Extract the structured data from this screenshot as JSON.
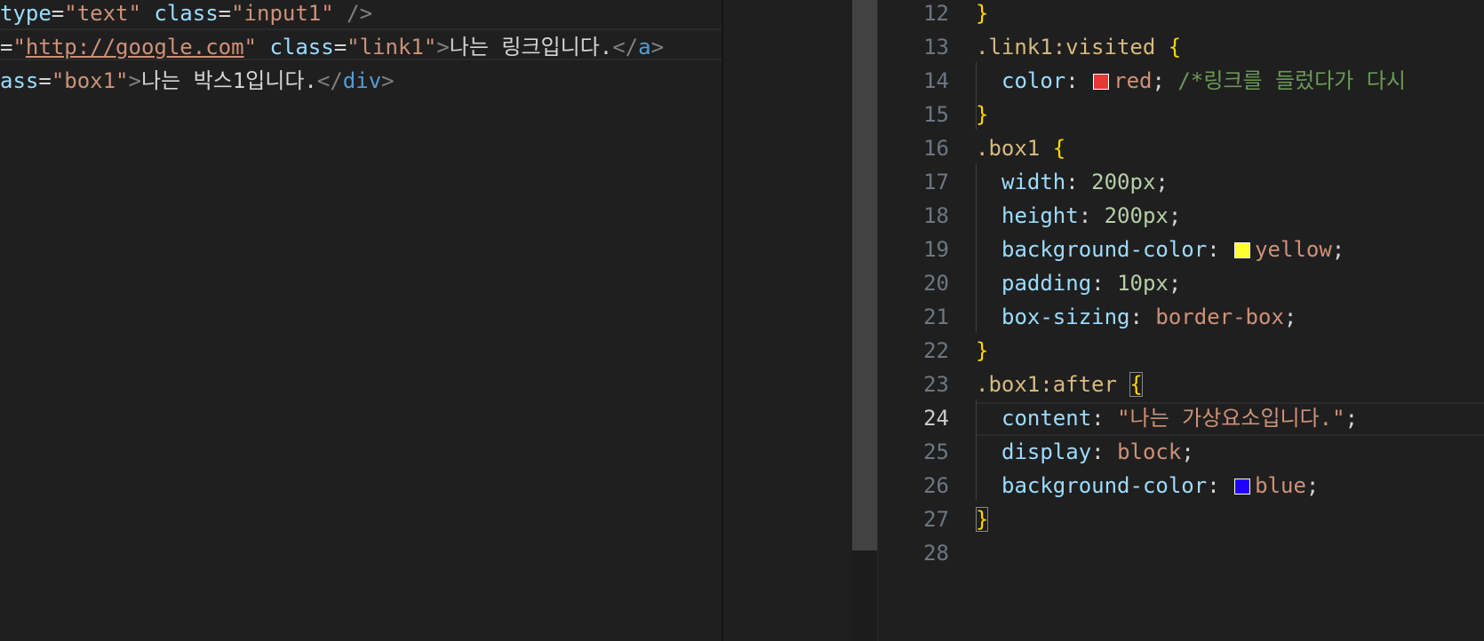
{
  "colors": {
    "background": "#1f1f1f",
    "swatch_red": "#e53935",
    "swatch_yellow": "#ffff33",
    "swatch_blue": "#2200ff"
  },
  "left_editor": {
    "lines": [
      {
        "tokens": [
          {
            "text": "type",
            "cls": "t-attr"
          },
          {
            "text": "=",
            "cls": "t-punct"
          },
          {
            "text": "\"text\"",
            "cls": "t-str"
          },
          {
            "text": " ",
            "cls": "t-punct"
          },
          {
            "text": "class",
            "cls": "t-attr"
          },
          {
            "text": "=",
            "cls": "t-punct"
          },
          {
            "text": "\"input1\"",
            "cls": "t-str"
          },
          {
            "text": " />",
            "cls": "t-tag"
          }
        ]
      },
      {
        "tokens": [
          {
            "text": "=",
            "cls": "t-punct"
          },
          {
            "text": "\"",
            "cls": "t-str"
          },
          {
            "text": "http://google.com",
            "cls": "t-link"
          },
          {
            "text": "\"",
            "cls": "t-str"
          },
          {
            "text": " ",
            "cls": "t-punct"
          },
          {
            "text": "class",
            "cls": "t-attr"
          },
          {
            "text": "=",
            "cls": "t-punct"
          },
          {
            "text": "\"link1\"",
            "cls": "t-str"
          },
          {
            "text": ">",
            "cls": "t-tag"
          },
          {
            "text": "나는 링크입니다.",
            "cls": "t-text"
          },
          {
            "text": "</",
            "cls": "t-tag"
          },
          {
            "text": "a",
            "cls": "t-tagname"
          },
          {
            "text": ">",
            "cls": "t-tag"
          }
        ]
      },
      {
        "tokens": [
          {
            "text": "ass",
            "cls": "t-attr"
          },
          {
            "text": "=",
            "cls": "t-punct"
          },
          {
            "text": "\"box1\"",
            "cls": "t-str"
          },
          {
            "text": ">",
            "cls": "t-tag"
          },
          {
            "text": "나는 박스1입니다.",
            "cls": "t-text"
          },
          {
            "text": "</",
            "cls": "t-tag"
          },
          {
            "text": "div",
            "cls": "t-tagname"
          },
          {
            "text": ">",
            "cls": "t-tag"
          }
        ]
      }
    ]
  },
  "right_editor": {
    "active_line": "24",
    "lines": [
      {
        "num": "12",
        "indent": 0,
        "tokens": [
          {
            "text": "}",
            "cls": "t-brace"
          }
        ]
      },
      {
        "num": "13",
        "indent": 0,
        "tokens": [
          {
            "text": ".link1:visited",
            "cls": "t-sel"
          },
          {
            "text": " ",
            "cls": "t-punct"
          },
          {
            "text": "{",
            "cls": "t-brace"
          }
        ]
      },
      {
        "num": "14",
        "indent": 1,
        "tokens": [
          {
            "text": "color",
            "cls": "t-prop"
          },
          {
            "text": ": ",
            "cls": "t-punct"
          },
          {
            "swatch": "swatch_red"
          },
          {
            "text": "red",
            "cls": "t-val"
          },
          {
            "text": "; ",
            "cls": "t-punct"
          },
          {
            "text": "/*링크를 들렀다가 다시",
            "cls": "t-comment"
          }
        ]
      },
      {
        "num": "15",
        "indent": 0,
        "tokens": [
          {
            "text": "}",
            "cls": "t-brace"
          }
        ]
      },
      {
        "num": "16",
        "indent": 0,
        "tokens": [
          {
            "text": ".box1",
            "cls": "t-sel"
          },
          {
            "text": " ",
            "cls": "t-punct"
          },
          {
            "text": "{",
            "cls": "t-brace"
          }
        ]
      },
      {
        "num": "17",
        "indent": 1,
        "tokens": [
          {
            "text": "width",
            "cls": "t-prop"
          },
          {
            "text": ": ",
            "cls": "t-punct"
          },
          {
            "text": "200px",
            "cls": "t-num"
          },
          {
            "text": ";",
            "cls": "t-punct"
          }
        ]
      },
      {
        "num": "18",
        "indent": 1,
        "tokens": [
          {
            "text": "height",
            "cls": "t-prop"
          },
          {
            "text": ": ",
            "cls": "t-punct"
          },
          {
            "text": "200px",
            "cls": "t-num"
          },
          {
            "text": ";",
            "cls": "t-punct"
          }
        ]
      },
      {
        "num": "19",
        "indent": 1,
        "tokens": [
          {
            "text": "background-color",
            "cls": "t-prop"
          },
          {
            "text": ": ",
            "cls": "t-punct"
          },
          {
            "swatch": "swatch_yellow"
          },
          {
            "text": "yellow",
            "cls": "t-val"
          },
          {
            "text": ";",
            "cls": "t-punct"
          }
        ]
      },
      {
        "num": "20",
        "indent": 1,
        "tokens": [
          {
            "text": "padding",
            "cls": "t-prop"
          },
          {
            "text": ": ",
            "cls": "t-punct"
          },
          {
            "text": "10px",
            "cls": "t-num"
          },
          {
            "text": ";",
            "cls": "t-punct"
          }
        ]
      },
      {
        "num": "21",
        "indent": 1,
        "tokens": [
          {
            "text": "box-sizing",
            "cls": "t-prop"
          },
          {
            "text": ": ",
            "cls": "t-punct"
          },
          {
            "text": "border-box",
            "cls": "t-val"
          },
          {
            "text": ";",
            "cls": "t-punct"
          }
        ]
      },
      {
        "num": "22",
        "indent": 0,
        "tokens": [
          {
            "text": "}",
            "cls": "t-brace"
          }
        ]
      },
      {
        "num": "23",
        "indent": 0,
        "tokens": [
          {
            "text": ".box1:after",
            "cls": "t-sel"
          },
          {
            "text": " ",
            "cls": "t-punct"
          },
          {
            "text": "{",
            "cls": "t-brace",
            "boxed": true
          }
        ]
      },
      {
        "num": "24",
        "indent": 1,
        "tokens": [
          {
            "text": "content",
            "cls": "t-prop"
          },
          {
            "text": ": ",
            "cls": "t-punct"
          },
          {
            "text": "\"나는 가상요소입니다.\"",
            "cls": "t-str"
          },
          {
            "text": ";",
            "cls": "t-punct"
          }
        ]
      },
      {
        "num": "25",
        "indent": 1,
        "tokens": [
          {
            "text": "display",
            "cls": "t-prop"
          },
          {
            "text": ": ",
            "cls": "t-punct"
          },
          {
            "text": "block",
            "cls": "t-val"
          },
          {
            "text": ";",
            "cls": "t-punct"
          }
        ]
      },
      {
        "num": "26",
        "indent": 1,
        "tokens": [
          {
            "text": "background-color",
            "cls": "t-prop"
          },
          {
            "text": ": ",
            "cls": "t-punct"
          },
          {
            "swatch": "swatch_blue"
          },
          {
            "text": "blue",
            "cls": "t-val"
          },
          {
            "text": ";",
            "cls": "t-punct"
          }
        ]
      },
      {
        "num": "27",
        "indent": 0,
        "tokens": [
          {
            "text": "}",
            "cls": "t-brace",
            "boxed": true
          }
        ]
      },
      {
        "num": "28",
        "indent": 0,
        "tokens": []
      }
    ]
  }
}
